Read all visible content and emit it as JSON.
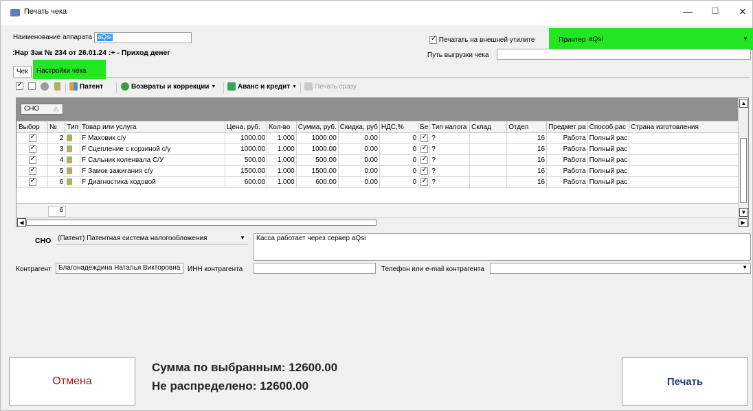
{
  "window": {
    "title": "Печать чека",
    "minimize": "—",
    "maximize": "☐",
    "close": "✕"
  },
  "device": {
    "name_label": "Наименование аппарата",
    "name_value": "aQsi"
  },
  "order_info": ":Нар Зак № 234 от 26.01.24 :+ - Приход денег",
  "print_external": {
    "label": "Печатать на внешней утилите",
    "checked": true
  },
  "printer": {
    "label": "Принтер",
    "value": "aQsi"
  },
  "export_path": {
    "label": "Путь выгрузки чека",
    "value": ""
  },
  "tabs": [
    {
      "label": "Чек"
    },
    {
      "label": "Настройки чека"
    }
  ],
  "toolbar": {
    "patent": "Патент",
    "returns": "Возвраты и коррекции",
    "advance": "Аванс и кредит",
    "print_now": "Печать сразу"
  },
  "grid": {
    "group_by": "СНО",
    "columns": [
      "Выбор",
      "№",
      "Тип",
      "Товар или услуга",
      "Цена, руб.",
      "Кол-во",
      "Сумма, руб.",
      "Скидка, руб",
      "НДС,%",
      "Бе",
      "Тип налога",
      "Склад",
      "Отдел",
      "Предмет ра",
      "Способ рас",
      "Страна изготовления"
    ],
    "rows": [
      {
        "num": "2",
        "type": "F",
        "item": "Маховик с/у",
        "price": "1000.00",
        "qty": "1.000",
        "sum": "1000.00",
        "discount": "0.00",
        "vat": "0",
        "tax_type": "?",
        "warehouse": "",
        "dept": "16",
        "subject": "Работа",
        "method": "Полный рас",
        "country": ""
      },
      {
        "num": "3",
        "type": "F",
        "item": "Сцепление с корзиной с/у",
        "price": "1000.00",
        "qty": "1.000",
        "sum": "1000.00",
        "discount": "0.00",
        "vat": "0",
        "tax_type": "?",
        "warehouse": "",
        "dept": "16",
        "subject": "Работа",
        "method": "Полный рас",
        "country": ""
      },
      {
        "num": "4",
        "type": "F",
        "item": "Сальник коленвала С/У",
        "price": "500.00",
        "qty": "1.000",
        "sum": "500.00",
        "discount": "0.00",
        "vat": "0",
        "tax_type": "?",
        "warehouse": "",
        "dept": "16",
        "subject": "Работа",
        "method": "Полный рас",
        "country": ""
      },
      {
        "num": "5",
        "type": "F",
        "item": "Замок зажигания с/у",
        "price": "1500.00",
        "qty": "1.000",
        "sum": "1500.00",
        "discount": "0.00",
        "vat": "0",
        "tax_type": "?",
        "warehouse": "",
        "dept": "16",
        "subject": "Работа",
        "method": "Полный рас",
        "country": ""
      },
      {
        "num": "6",
        "type": "F",
        "item": "Диагностика ходовой",
        "price": "600.00",
        "qty": "1.000",
        "sum": "600.00",
        "discount": "0.00",
        "vat": "0",
        "tax_type": "?",
        "warehouse": "",
        "dept": "16",
        "subject": "Работа",
        "method": "Полный рас",
        "country": ""
      }
    ],
    "row_count": "6"
  },
  "sno": {
    "label": "СНО",
    "value": "(Патент) Патентная система налогообложения",
    "note": "Касса работает через сервер aQsi"
  },
  "counterparty": {
    "label": "Контрагент",
    "value": "Благонадеждина Наталья Викторовна",
    "inn_label": "ИНН контрагента",
    "inn_value": "",
    "contact_label": "Телефон или e-mail контрагента",
    "contact_value": ""
  },
  "buttons": {
    "cancel": "Отмена",
    "print": "Печать"
  },
  "totals": {
    "selected": "Сумма по выбранным: 12600.00",
    "unallocated": "Не распределено: 12600.00"
  },
  "colors": {
    "highlight": "#22e622",
    "cancel_text": "#a21a1a",
    "print_text": "#1f3f7a"
  }
}
